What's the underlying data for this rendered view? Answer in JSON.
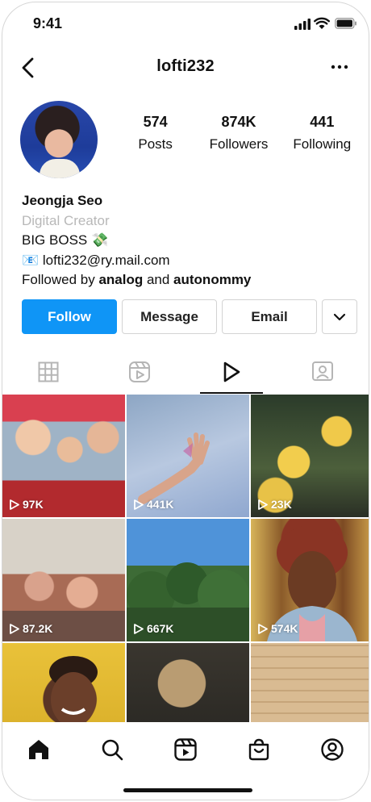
{
  "status_bar": {
    "time": "9:41"
  },
  "header": {
    "username": "lofti232"
  },
  "profile": {
    "stats": [
      {
        "count": "574",
        "label": "Posts"
      },
      {
        "count": "874K",
        "label": "Followers"
      },
      {
        "count": "441",
        "label": "Following"
      }
    ],
    "name": "Jeongja Seo",
    "category": "Digital Creator",
    "bio_line": "BIG BOSS 💸",
    "email_line": "📧 lofti232@ry.mail.com",
    "followed_by_prefix": "Followed by ",
    "followed_by_user1": "analog",
    "followed_by_and": " and ",
    "followed_by_user2": "autonommy"
  },
  "actions": {
    "follow": "Follow",
    "message": "Message",
    "email": "Email"
  },
  "tabs": [
    "grid",
    "reels",
    "videos",
    "tagged"
  ],
  "active_tab": "videos",
  "grid": [
    {
      "views": "97K"
    },
    {
      "views": "441K"
    },
    {
      "views": "23K"
    },
    {
      "views": "87.2K"
    },
    {
      "views": "667K"
    },
    {
      "views": "574K"
    },
    {
      "views": ""
    },
    {
      "views": ""
    },
    {
      "views": ""
    }
  ],
  "nav": [
    "home-icon",
    "search-icon",
    "reels-icon",
    "shop-icon",
    "profile-icon"
  ],
  "colors": {
    "follow_button": "#0f95f6",
    "category_text": "#b8b8b8"
  }
}
